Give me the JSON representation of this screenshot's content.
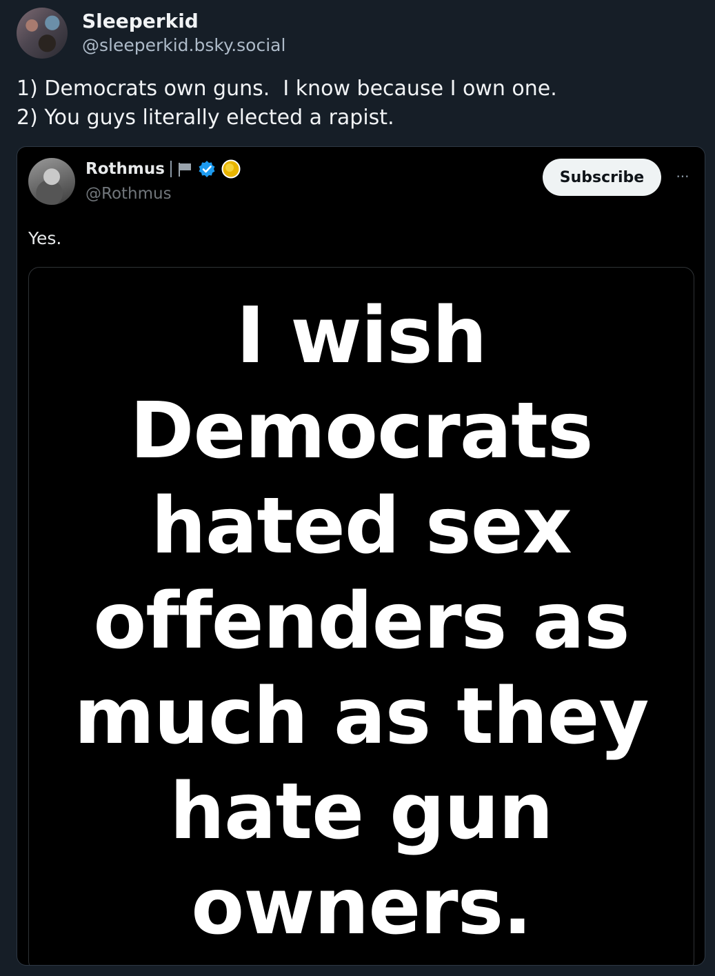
{
  "post": {
    "author": {
      "display_name": "Sleeperkid",
      "handle": "@sleeperkid.bsky.social"
    },
    "text_lines": [
      "1) Democrats own guns.  I know because I own one.",
      "2) You guys literally elected a rapist."
    ]
  },
  "quoted": {
    "author": {
      "display_name": "Rothmus",
      "handle": "@Rothmus",
      "badges": [
        "flag-icon",
        "verified-icon",
        "gold-circle-icon"
      ]
    },
    "subscribe_label": "Subscribe",
    "more_label": "···",
    "text": "Yes.",
    "image_text_lines": [
      "I wish",
      "Democrats",
      "hated sex",
      "offenders as",
      "much as they",
      "hate gun",
      "owners."
    ]
  },
  "colors": {
    "background": "#161e27",
    "embed_background": "#000000",
    "verified_blue": "#1d9bf0",
    "gold": "#e8b400"
  }
}
